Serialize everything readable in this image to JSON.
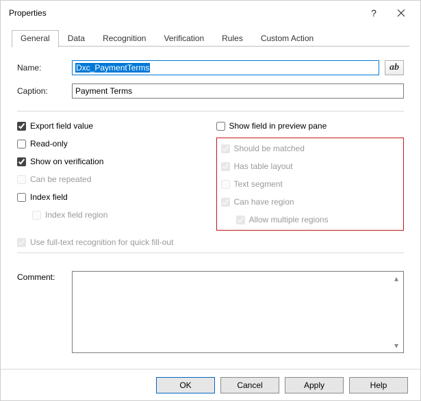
{
  "window": {
    "title": "Properties"
  },
  "tabs": {
    "general": "General",
    "data": "Data",
    "recognition": "Recognition",
    "verification": "Verification",
    "rules": "Rules",
    "custom_action": "Custom Action"
  },
  "fields": {
    "name_label": "Name:",
    "name_value": "Dxc_PaymentTerms",
    "caption_label": "Caption:",
    "caption_value": "Payment Terms",
    "comment_label": "Comment:",
    "comment_value": ""
  },
  "checks_left": {
    "export_field_value": "Export field value",
    "read_only": "Read-only",
    "show_on_verification": "Show on verification",
    "can_be_repeated": "Can be repeated",
    "index_field": "Index field",
    "index_field_region": "Index field region",
    "full_text_recognition": "Use full-text recognition for quick fill-out"
  },
  "checks_right": {
    "show_field_preview": "Show field in preview pane",
    "should_be_matched": "Should be matched",
    "has_table_layout": "Has table layout",
    "text_segment": "Text segment",
    "can_have_region": "Can have region",
    "allow_multiple_regions": "Allow multiple regions"
  },
  "buttons": {
    "ok": "OK",
    "cancel": "Cancel",
    "apply": "Apply",
    "help": "Help"
  },
  "icons": {
    "ab": "ab"
  }
}
